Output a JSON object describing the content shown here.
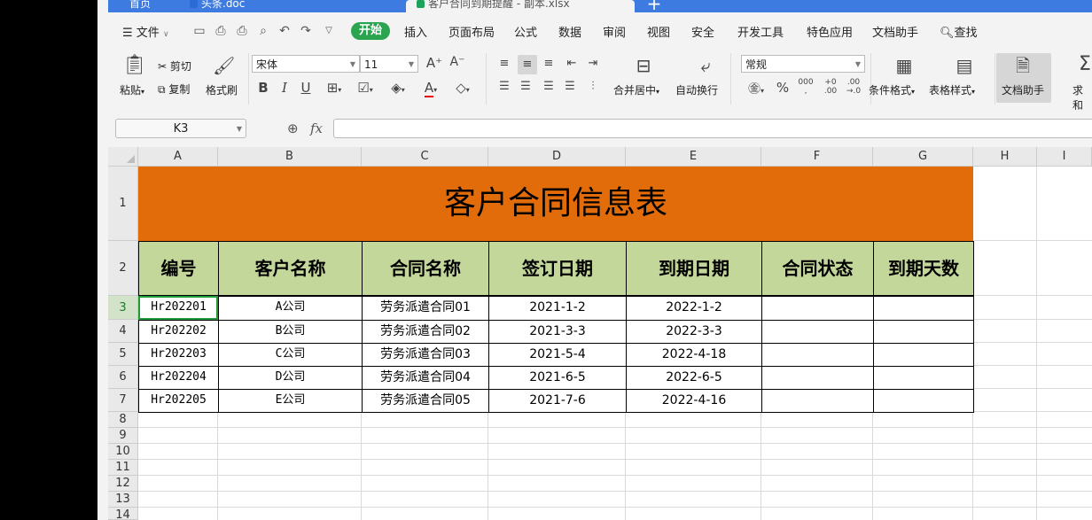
{
  "tabs": {
    "home": "首页",
    "doc": "头条.doc",
    "xlsx": "客户合同到期提醒 - 副本.xlsx",
    "add": "+"
  },
  "menu": {
    "file": "文件",
    "start": "开始",
    "items": [
      "插入",
      "页面布局",
      "公式",
      "数据",
      "审阅",
      "视图",
      "安全",
      "开发工具",
      "特色应用",
      "文档助手"
    ],
    "search": "查找"
  },
  "ribbon": {
    "paste": "粘贴",
    "cut": "剪切",
    "copy": "复制",
    "format_painter": "格式刷",
    "font_name": "宋体",
    "font_size": "11",
    "merge_center": "合并居中",
    "wrap_text": "自动换行",
    "number_format": "常规",
    "cond_format": "条件格式",
    "table_style": "表格样式",
    "doc_helper": "文档助手",
    "sum": "求和"
  },
  "formula_bar": {
    "name_box": "K3",
    "fx": "fx"
  },
  "columns": [
    "A",
    "B",
    "C",
    "D",
    "E",
    "F",
    "G",
    "H",
    "I"
  ],
  "rows": [
    "1",
    "2",
    "3",
    "4",
    "5",
    "6",
    "7",
    "8",
    "9",
    "10",
    "11",
    "12",
    "13",
    "14"
  ],
  "sheet": {
    "title": "客户合同信息表",
    "headers": [
      "编号",
      "客户名称",
      "合同名称",
      "签订日期",
      "到期日期",
      "合同状态",
      "到期天数"
    ],
    "records": [
      {
        "id": "Hr202201",
        "client": "A公司",
        "contract": "劳务派遣合同01",
        "signed": "2021-1-2",
        "expires": "2022-1-2",
        "status": "",
        "days": ""
      },
      {
        "id": "Hr202202",
        "client": "B公司",
        "contract": "劳务派遣合同02",
        "signed": "2021-3-3",
        "expires": "2022-3-3",
        "status": "",
        "days": ""
      },
      {
        "id": "Hr202203",
        "client": "C公司",
        "contract": "劳务派遣合同03",
        "signed": "2021-5-4",
        "expires": "2022-4-18",
        "status": "",
        "days": ""
      },
      {
        "id": "Hr202204",
        "client": "D公司",
        "contract": "劳务派遣合同04",
        "signed": "2021-6-5",
        "expires": "2022-6-5",
        "status": "",
        "days": ""
      },
      {
        "id": "Hr202205",
        "client": "E公司",
        "contract": "劳务派遣合同05",
        "signed": "2021-7-6",
        "expires": "2022-4-16",
        "status": "",
        "days": ""
      }
    ]
  },
  "colors": {
    "title_bg": "#e36c0a",
    "header_bg": "#c4d79b",
    "start_green": "#2aa44f",
    "tab_blue": "#3d7be0"
  }
}
